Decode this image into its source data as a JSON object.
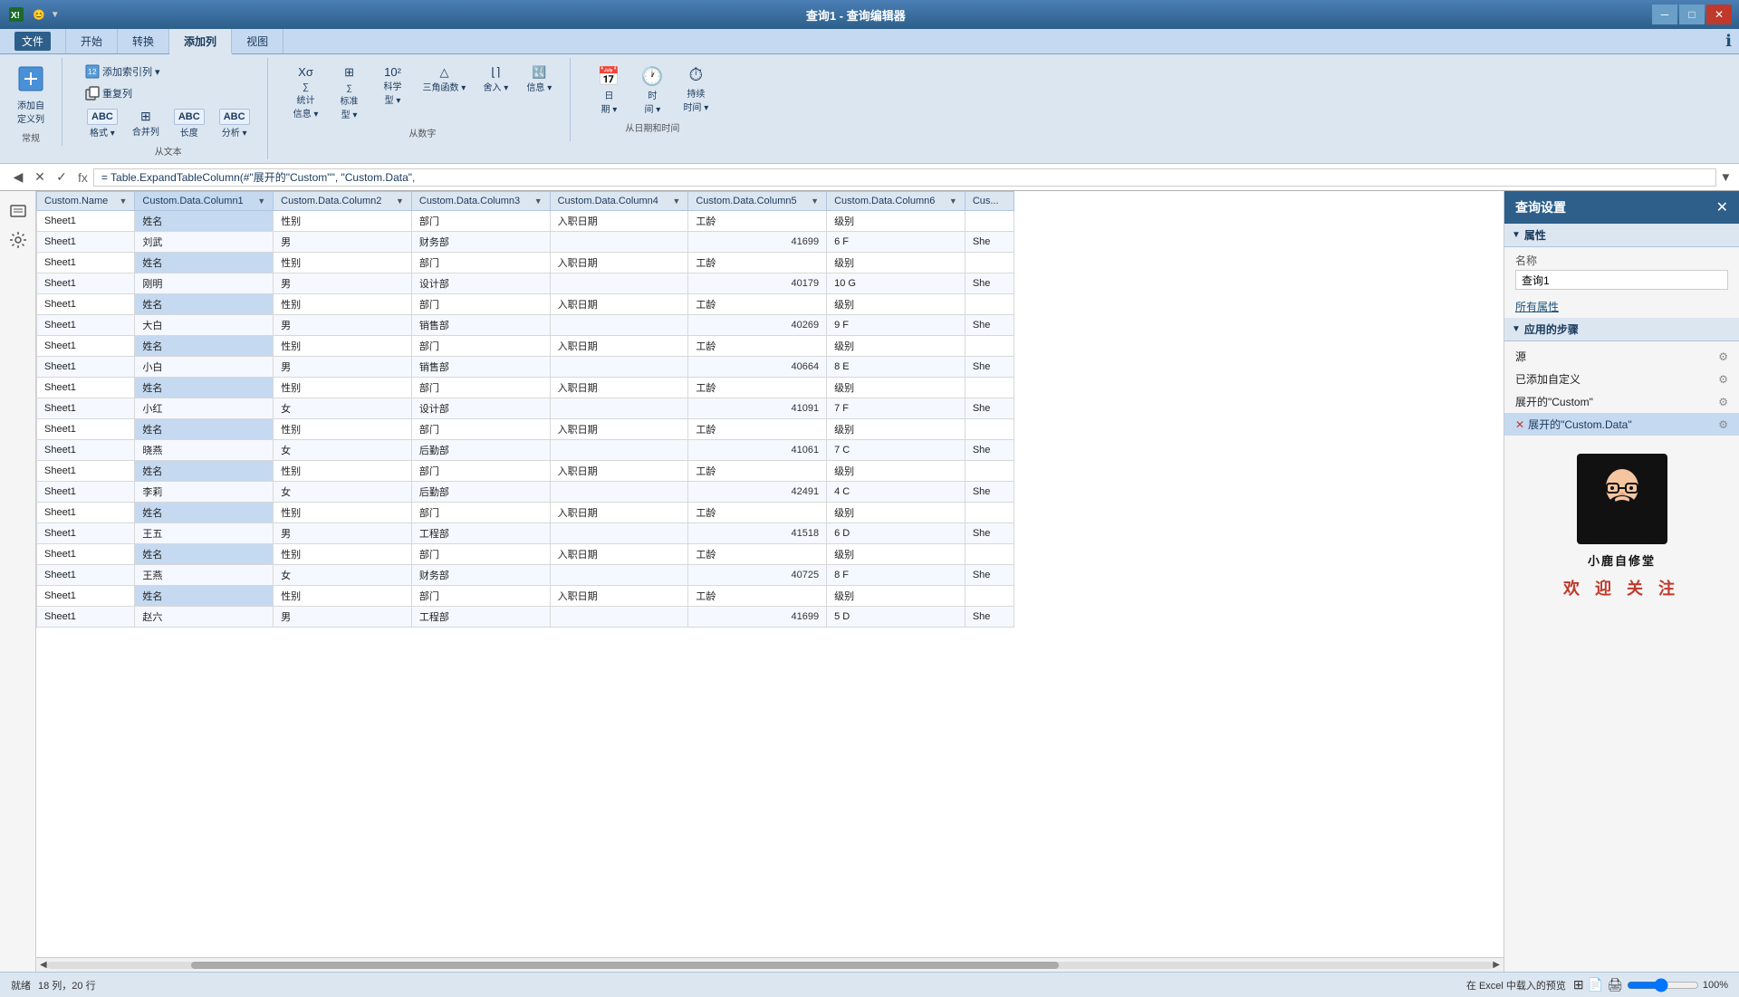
{
  "titleBar": {
    "title": "查询1 - 查询编辑器",
    "icon": "📊"
  },
  "ribbonTabs": [
    {
      "id": "file",
      "label": "文件",
      "active": false
    },
    {
      "id": "home",
      "label": "开始",
      "active": false
    },
    {
      "id": "transform",
      "label": "转换",
      "active": false
    },
    {
      "id": "addColumn",
      "label": "添加列",
      "active": true
    },
    {
      "id": "view",
      "label": "视图",
      "active": false
    }
  ],
  "ribbonGroups": [
    {
      "id": "general",
      "label": "常规",
      "buttons": [
        {
          "id": "addCustomCol",
          "icon": "▦",
          "label": "添加自\n定义列",
          "type": "large"
        }
      ]
    },
    {
      "id": "fromText",
      "label": "从文本",
      "buttons": [
        {
          "id": "addIndexCol",
          "icon": "🔢",
          "label": "添加索引列 ▾",
          "type": "small"
        },
        {
          "id": "duplicate",
          "icon": "🗐",
          "label": "重复列",
          "type": "small"
        },
        {
          "id": "format",
          "icon": "ABC",
          "label": "格式 ▾",
          "type": "icon"
        },
        {
          "id": "merge",
          "icon": "⊞",
          "label": "合并列",
          "type": "icon"
        },
        {
          "id": "length",
          "icon": "ABC",
          "label": "长度",
          "type": "icon"
        },
        {
          "id": "analyze",
          "icon": "ABC",
          "label": "分析 ▾",
          "type": "icon"
        }
      ]
    },
    {
      "id": "fromNumber",
      "label": "从数字",
      "buttons": [
        {
          "id": "stats",
          "icon": "Xσ",
          "label": "统计\n信息 ▾",
          "type": "medium"
        },
        {
          "id": "standard",
          "icon": "∑",
          "label": "标准\n型 ▾",
          "type": "medium"
        },
        {
          "id": "scientific",
          "icon": "10²",
          "label": "科学\n型 ▾",
          "type": "medium"
        },
        {
          "id": "trig",
          "icon": "△",
          "label": "三角函数 ▾",
          "type": "medium"
        },
        {
          "id": "rounding",
          "icon": "⌊⌉",
          "label": "舍入 ▾",
          "type": "medium"
        },
        {
          "id": "info",
          "icon": "ℹ",
          "label": "信息 ▾",
          "type": "medium"
        }
      ]
    },
    {
      "id": "fromDate",
      "label": "从日期和时间",
      "buttons": [
        {
          "id": "date",
          "icon": "📅",
          "label": "日\n期 ▾",
          "type": "medium"
        },
        {
          "id": "time",
          "icon": "🕐",
          "label": "时\n间 ▾",
          "type": "medium"
        },
        {
          "id": "duration",
          "icon": "⏱",
          "label": "持续\n时间 ▾",
          "type": "medium"
        }
      ]
    }
  ],
  "formulaBar": {
    "value": "= Table.ExpandTableColumn(#\"展开的\"Custom\"\", \"Custom.Data\","
  },
  "tableColumns": [
    {
      "id": "customName",
      "label": "Custom.Name",
      "hasFilter": true
    },
    {
      "id": "col1",
      "label": "Custom.Data.Column1",
      "hasFilter": true
    },
    {
      "id": "col2",
      "label": "Custom.Data.Column2",
      "hasFilter": true
    },
    {
      "id": "col3",
      "label": "Custom.Data.Column3",
      "hasFilter": true
    },
    {
      "id": "col4",
      "label": "Custom.Data.Column4",
      "hasFilter": true
    },
    {
      "id": "col5",
      "label": "Custom.Data.Column5",
      "hasFilter": true
    },
    {
      "id": "col6",
      "label": "Custom.Data.Column6",
      "hasFilter": true
    },
    {
      "id": "cus",
      "label": "Cus...",
      "hasFilter": false
    }
  ],
  "tableData": [
    {
      "customName": "Sheet1",
      "col1": "姓名",
      "col2": "性别",
      "col3": "部门",
      "col4": "入职日期",
      "col5": "工龄",
      "col6": "级别",
      "extra": ""
    },
    {
      "customName": "Sheet1",
      "col1": "刘武",
      "col2": "男",
      "col3": "财务部",
      "col4": "",
      "col5": "41699",
      "col6": "6 F",
      "extra": "She"
    },
    {
      "customName": "Sheet1",
      "col1": "姓名",
      "col2": "性别",
      "col3": "部门",
      "col4": "入职日期",
      "col5": "工龄",
      "col6": "级别",
      "extra": ""
    },
    {
      "customName": "Sheet1",
      "col1": "刚明",
      "col2": "男",
      "col3": "设计部",
      "col4": "",
      "col5": "40179",
      "col6": "10 G",
      "extra": "She"
    },
    {
      "customName": "Sheet1",
      "col1": "姓名",
      "col2": "性别",
      "col3": "部门",
      "col4": "入职日期",
      "col5": "工龄",
      "col6": "级别",
      "extra": ""
    },
    {
      "customName": "Sheet1",
      "col1": "大白",
      "col2": "男",
      "col3": "销售部",
      "col4": "",
      "col5": "40269",
      "col6": "9 F",
      "extra": "She"
    },
    {
      "customName": "Sheet1",
      "col1": "姓名",
      "col2": "性别",
      "col3": "部门",
      "col4": "入职日期",
      "col5": "工龄",
      "col6": "级别",
      "extra": ""
    },
    {
      "customName": "Sheet1",
      "col1": "小白",
      "col2": "男",
      "col3": "销售部",
      "col4": "",
      "col5": "40664",
      "col6": "8 E",
      "extra": "She"
    },
    {
      "customName": "Sheet1",
      "col1": "姓名",
      "col2": "性别",
      "col3": "部门",
      "col4": "入职日期",
      "col5": "工龄",
      "col6": "级别",
      "extra": ""
    },
    {
      "customName": "Sheet1",
      "col1": "小红",
      "col2": "女",
      "col3": "设计部",
      "col4": "",
      "col5": "41091",
      "col6": "7 F",
      "extra": "She"
    },
    {
      "customName": "Sheet1",
      "col1": "姓名",
      "col2": "性别",
      "col3": "部门",
      "col4": "入职日期",
      "col5": "工龄",
      "col6": "级别",
      "extra": ""
    },
    {
      "customName": "Sheet1",
      "col1": "晓燕",
      "col2": "女",
      "col3": "后勤部",
      "col4": "",
      "col5": "41061",
      "col6": "7 C",
      "extra": "She"
    },
    {
      "customName": "Sheet1",
      "col1": "姓名",
      "col2": "性别",
      "col3": "部门",
      "col4": "入职日期",
      "col5": "工龄",
      "col6": "级别",
      "extra": ""
    },
    {
      "customName": "Sheet1",
      "col1": "李莉",
      "col2": "女",
      "col3": "后勤部",
      "col4": "",
      "col5": "42491",
      "col6": "4 C",
      "extra": "She"
    },
    {
      "customName": "Sheet1",
      "col1": "姓名",
      "col2": "性别",
      "col3": "部门",
      "col4": "入职日期",
      "col5": "工龄",
      "col6": "级别",
      "extra": ""
    },
    {
      "customName": "Sheet1",
      "col1": "王五",
      "col2": "男",
      "col3": "工程部",
      "col4": "",
      "col5": "41518",
      "col6": "6 D",
      "extra": "She"
    },
    {
      "customName": "Sheet1",
      "col1": "姓名",
      "col2": "性别",
      "col3": "部门",
      "col4": "入职日期",
      "col5": "工龄",
      "col6": "级别",
      "extra": ""
    },
    {
      "customName": "Sheet1",
      "col1": "王燕",
      "col2": "女",
      "col3": "财务部",
      "col4": "",
      "col5": "40725",
      "col6": "8 F",
      "extra": "She"
    },
    {
      "customName": "Sheet1",
      "col1": "姓名",
      "col2": "性别",
      "col3": "部门",
      "col4": "入职日期",
      "col5": "工龄",
      "col6": "级别",
      "extra": ""
    },
    {
      "customName": "Sheet1",
      "col1": "赵六",
      "col2": "男",
      "col3": "工程部",
      "col4": "",
      "col5": "41699",
      "col6": "5 D",
      "extra": "She"
    }
  ],
  "rightPanel": {
    "title": "查询设置",
    "propertySection": "属性",
    "nameLabel": "名称",
    "queryName": "查询1",
    "allPropsLink": "所有属性",
    "stepsSection": "应用的步骤",
    "steps": [
      {
        "id": "source",
        "label": "源",
        "hasGear": true,
        "hasX": false,
        "active": false,
        "error": false
      },
      {
        "id": "addCustom",
        "label": "已添加自定义",
        "hasGear": true,
        "hasX": false,
        "active": false,
        "error": false
      },
      {
        "id": "expandCustom",
        "label": "展开的\"Custom\"",
        "hasGear": true,
        "hasX": false,
        "active": false,
        "error": false
      },
      {
        "id": "expandCustomData",
        "label": "展开的\"Custom.Data\"",
        "hasGear": true,
        "hasX": true,
        "active": true,
        "error": false
      }
    ],
    "avatarText": "小鹿自修堂",
    "welcomeText": "欢 迎 关 注"
  },
  "statusBar": {
    "info": "就绪",
    "rows": "18 列，20 行",
    "preview": "在 Excel 中载入的预览",
    "zoom": "100%"
  }
}
